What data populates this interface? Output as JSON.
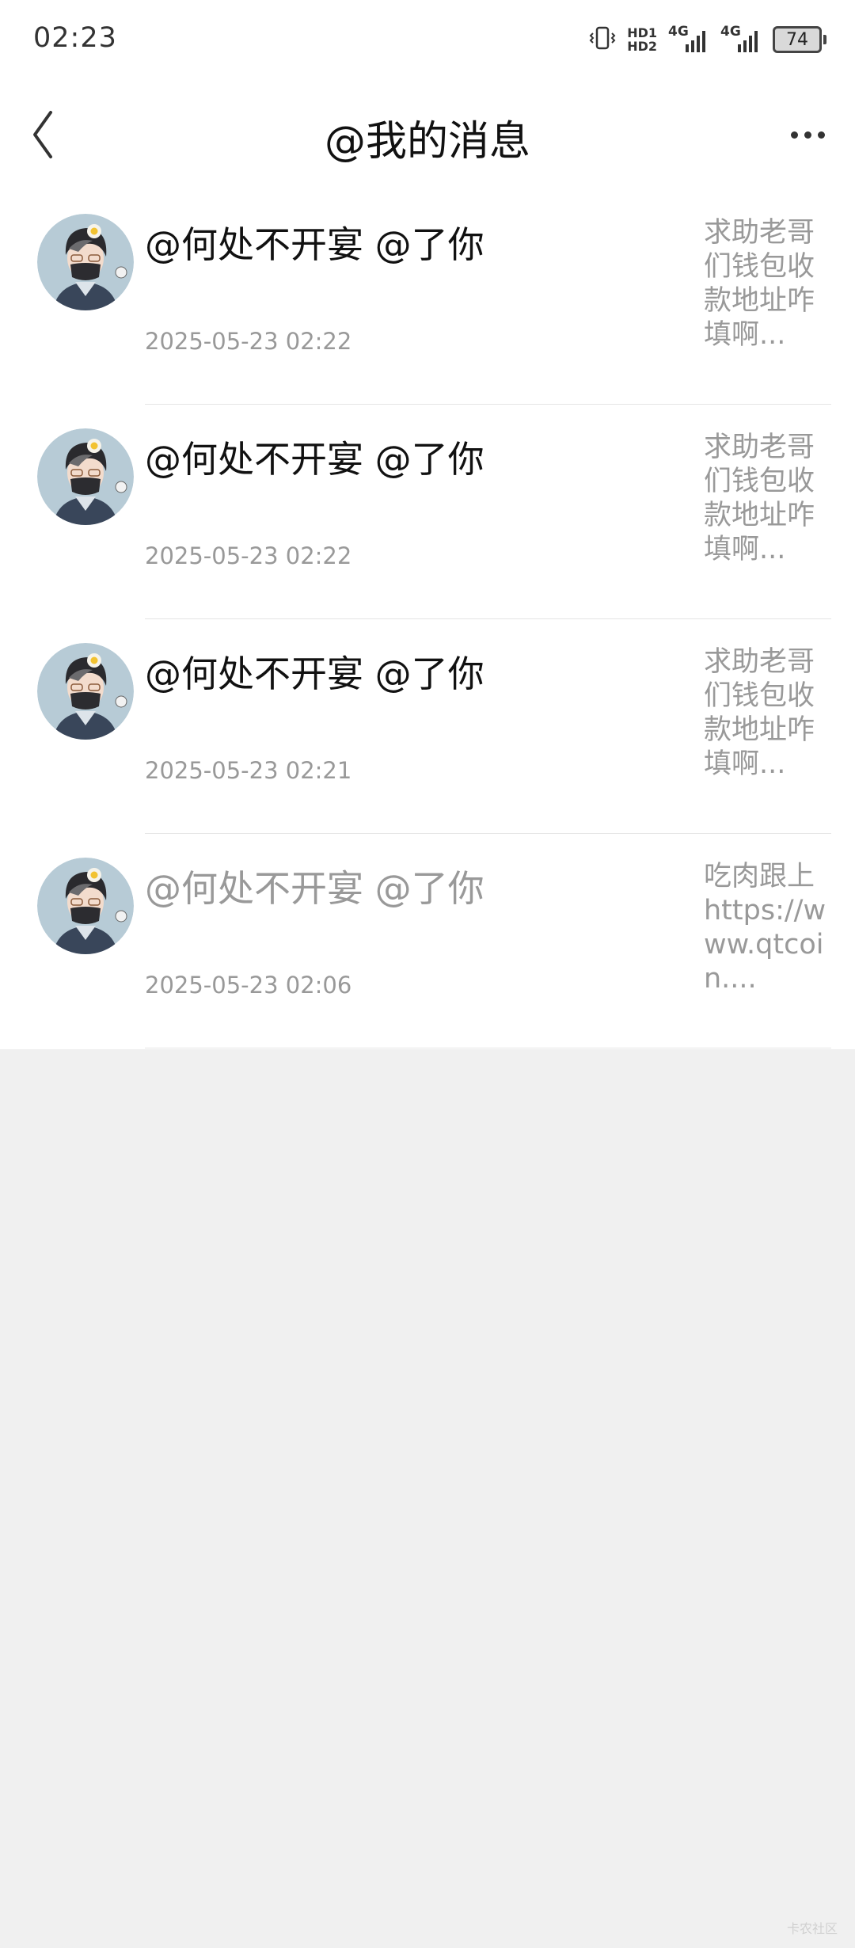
{
  "status_bar": {
    "time": "02:23",
    "hd_top": "HD1",
    "hd_bottom": "HD2",
    "network_1": "4G",
    "network_2": "4G",
    "battery": "74"
  },
  "header": {
    "title": "@我的消息",
    "back_icon": "chevron-left-icon",
    "more_icon": "more-dots-icon"
  },
  "messages": [
    {
      "title": "@何处不开宴 @了你",
      "time": "2025-05-23 02:22",
      "preview": "求助老哥们钱包收款地址咋填啊...",
      "read": false
    },
    {
      "title": "@何处不开宴 @了你",
      "time": "2025-05-23 02:22",
      "preview": "求助老哥们钱包收款地址咋填啊...",
      "read": false
    },
    {
      "title": "@何处不开宴 @了你",
      "time": "2025-05-23 02:21",
      "preview": "求助老哥们钱包收款地址咋填啊...",
      "read": false
    },
    {
      "title": "@何处不开宴 @了你",
      "time": "2025-05-23 02:06",
      "preview": "吃肉跟上https://www.qtcoin....",
      "read": true
    }
  ],
  "watermark": "卡农社区",
  "colors": {
    "background": "#f0f0f0",
    "panel": "#ffffff",
    "text_primary": "#111111",
    "text_secondary": "#999999",
    "divider": "#e5e5e5"
  }
}
